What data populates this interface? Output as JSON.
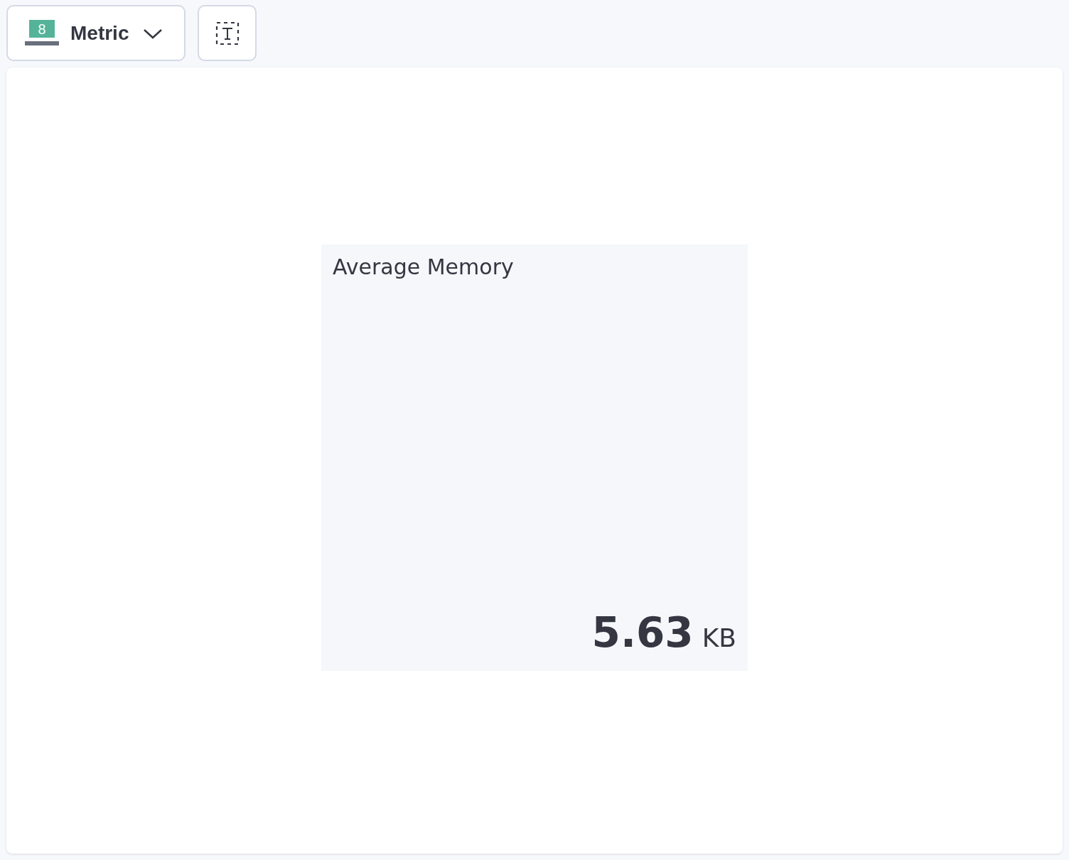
{
  "toolbar": {
    "chart_type": {
      "label": "Metric",
      "icon_text": "8"
    }
  },
  "metric": {
    "title": "Average Memory",
    "value": "5.63",
    "unit": "KB"
  }
}
